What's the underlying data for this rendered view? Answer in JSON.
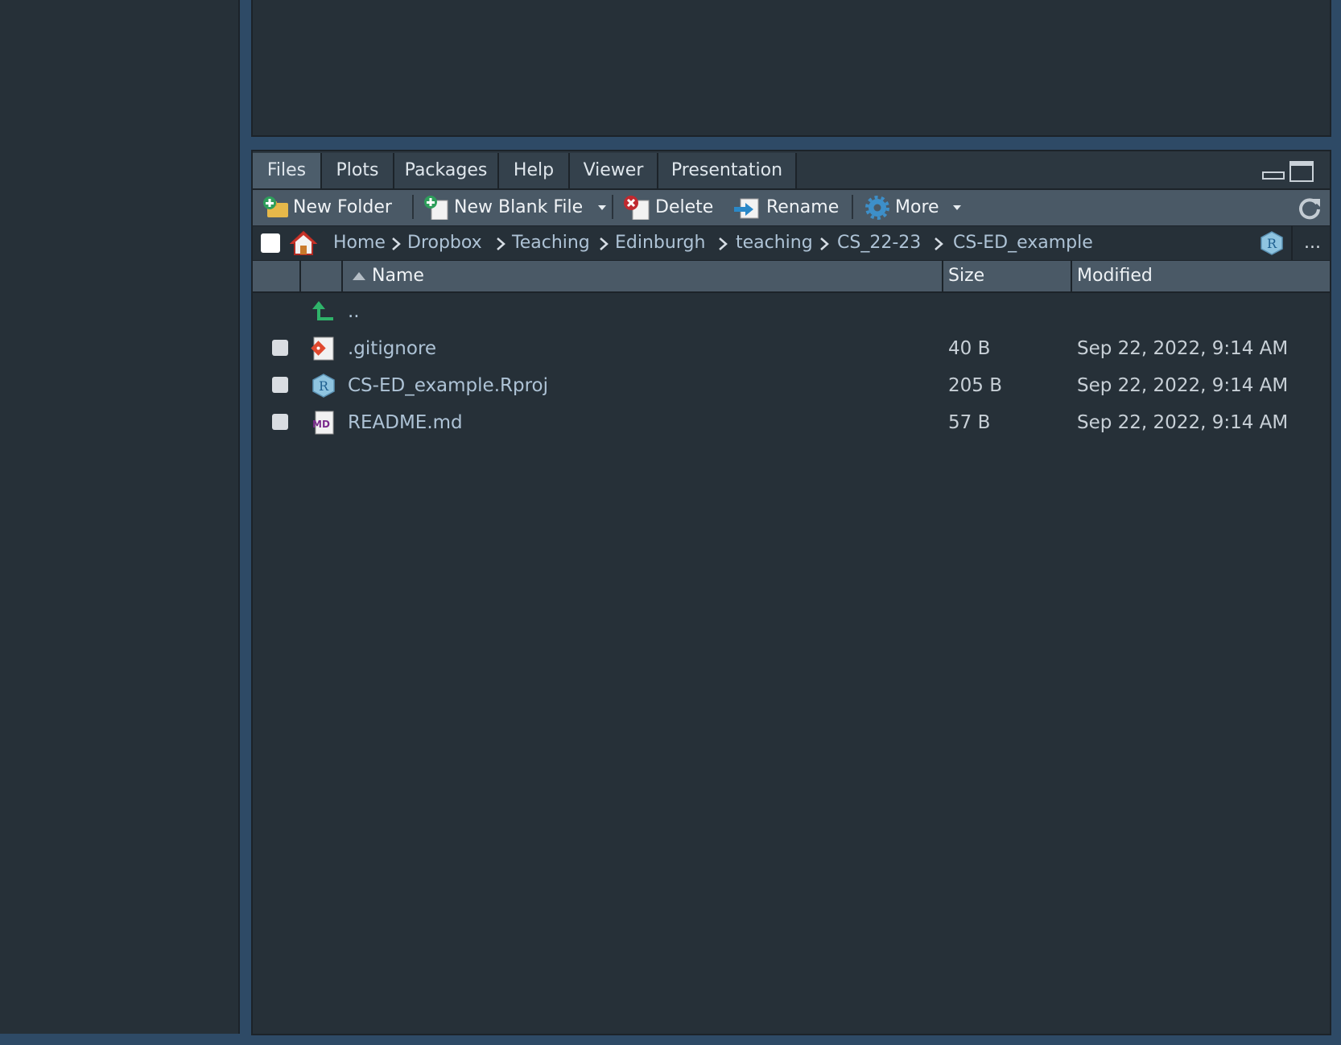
{
  "tabs": [
    {
      "label": "Files",
      "active": true
    },
    {
      "label": "Plots"
    },
    {
      "label": "Packages"
    },
    {
      "label": "Help"
    },
    {
      "label": "Viewer"
    },
    {
      "label": "Presentation"
    }
  ],
  "toolbar": {
    "new_folder": "New Folder",
    "new_blank_file": "New Blank File",
    "delete": "Delete",
    "rename": "Rename",
    "more": "More"
  },
  "breadcrumb": [
    "Home",
    "Dropbox",
    "Teaching",
    "Edinburgh",
    "teaching",
    "CS_22-23",
    "CS-ED_example"
  ],
  "pathbar": {
    "overflow": "..."
  },
  "columns": {
    "name": "Name",
    "size": "Size",
    "modified": "Modified"
  },
  "parent_dir": "..",
  "files": [
    {
      "name": ".gitignore",
      "size": "40 B",
      "modified": "Sep 22, 2022, 9:14 AM",
      "icon": "git-file-icon"
    },
    {
      "name": "CS-ED_example.Rproj",
      "size": "205 B",
      "modified": "Sep 22, 2022, 9:14 AM",
      "icon": "rproj-file-icon"
    },
    {
      "name": "README.md",
      "size": "57 B",
      "modified": "Sep 22, 2022, 9:14 AM",
      "icon": "markdown-file-icon"
    }
  ],
  "colors": {
    "background": "#263038",
    "toolbar": "#4a5966",
    "link": "#aec3d6",
    "frame": "#2e4a66"
  }
}
